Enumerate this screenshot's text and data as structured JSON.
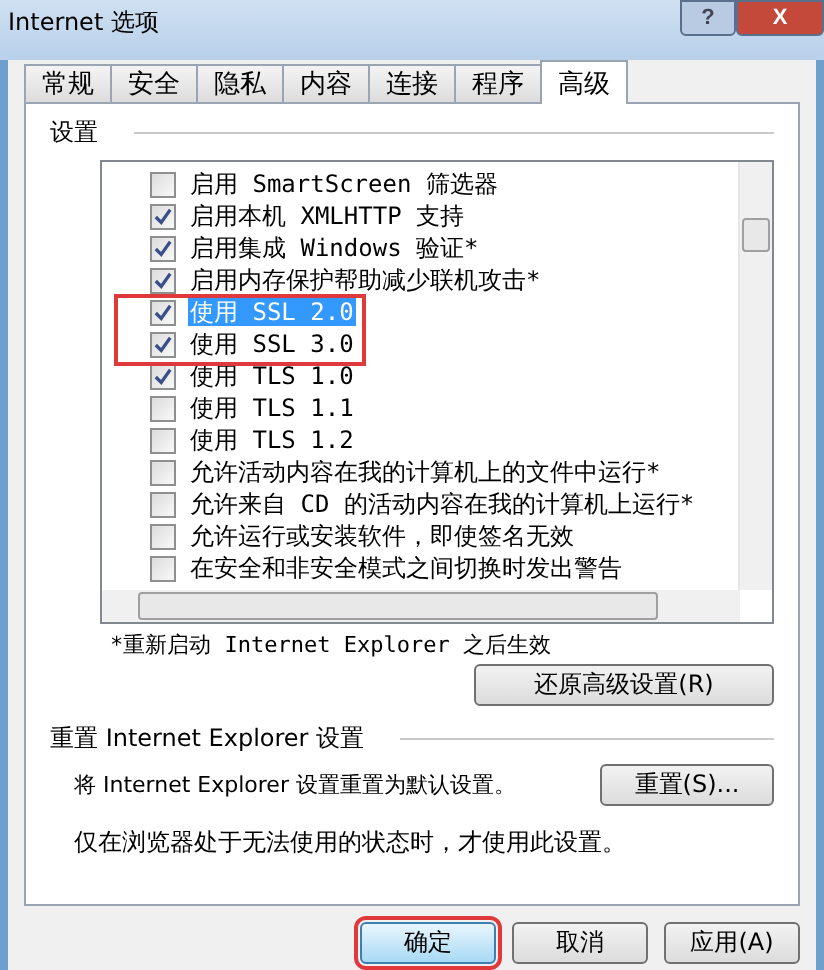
{
  "window": {
    "title": "Internet 选项",
    "help": "?",
    "close": "X"
  },
  "tabs": [
    {
      "label": "常规",
      "selected": false
    },
    {
      "label": "安全",
      "selected": false
    },
    {
      "label": "隐私",
      "selected": false
    },
    {
      "label": "内容",
      "selected": false
    },
    {
      "label": "连接",
      "selected": false
    },
    {
      "label": "程序",
      "selected": false
    },
    {
      "label": "高级",
      "selected": true
    }
  ],
  "settings": {
    "title": "设置",
    "items": [
      {
        "label": "启用 SmartScreen 筛选器",
        "checked": false,
        "selected": false,
        "highlighted": false
      },
      {
        "label": "启用本机 XMLHTTP 支持",
        "checked": true,
        "selected": false,
        "highlighted": false
      },
      {
        "label": "启用集成 Windows 验证*",
        "checked": true,
        "selected": false,
        "highlighted": false
      },
      {
        "label": "启用内存保护帮助减少联机攻击*",
        "checked": true,
        "selected": false,
        "highlighted": false
      },
      {
        "label": "使用 SSL 2.0",
        "checked": true,
        "selected": true,
        "highlighted": true
      },
      {
        "label": "使用 SSL 3.0",
        "checked": true,
        "selected": false,
        "highlighted": true
      },
      {
        "label": "使用 TLS 1.0",
        "checked": true,
        "selected": false,
        "highlighted": false
      },
      {
        "label": "使用 TLS 1.1",
        "checked": false,
        "selected": false,
        "highlighted": false
      },
      {
        "label": "使用 TLS 1.2",
        "checked": false,
        "selected": false,
        "highlighted": false
      },
      {
        "label": "允许活动内容在我的计算机上的文件中运行*",
        "checked": false,
        "selected": false,
        "highlighted": false
      },
      {
        "label": "允许来自 CD 的活动内容在我的计算机上运行*",
        "checked": false,
        "selected": false,
        "highlighted": false
      },
      {
        "label": "允许运行或安装软件，即使签名无效",
        "checked": false,
        "selected": false,
        "highlighted": false
      },
      {
        "label": "在安全和非安全模式之间切换时发出警告",
        "checked": false,
        "selected": false,
        "highlighted": false
      }
    ],
    "note": "*重新启动 Internet Explorer 之后生效",
    "restore_button": "还原高级设置(R)"
  },
  "reset": {
    "title": "重置 Internet Explorer 设置",
    "description": "将 Internet Explorer 设置重置为默认设置。",
    "button": "重置(S)...",
    "hint": "仅在浏览器处于无法使用的状态时，才使用此设置。"
  },
  "buttons": [
    {
      "label": "确定",
      "highlighted": true
    },
    {
      "label": "取消",
      "highlighted": false
    },
    {
      "label": "应用(A)",
      "highlighted": false
    }
  ]
}
